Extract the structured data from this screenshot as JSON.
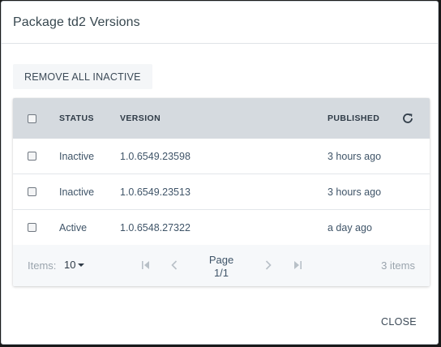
{
  "dialog": {
    "title": "Package td2 Versions",
    "remove_all_label": "REMOVE ALL INACTIVE",
    "close_label": "CLOSE"
  },
  "table": {
    "headers": {
      "status": "STATUS",
      "version": "VERSION",
      "published": "PUBLISHED"
    },
    "rows": [
      {
        "status": "Inactive",
        "version": "1.0.6549.23598",
        "published": "3 hours ago"
      },
      {
        "status": "Inactive",
        "version": "1.0.6549.23513",
        "published": "3 hours ago"
      },
      {
        "status": "Active",
        "version": "1.0.6548.27322",
        "published": "a day ago"
      }
    ]
  },
  "pager": {
    "items_label": "Items:",
    "page_size": "10",
    "page_label": "Page",
    "page_value": "1/1",
    "items_count": "3 items"
  },
  "icons": {
    "refresh": "refresh-icon",
    "first": "first-page-icon",
    "prev": "prev-page-icon",
    "next": "next-page-icon",
    "last": "last-page-icon",
    "dropdown": "chevron-down-icon"
  }
}
